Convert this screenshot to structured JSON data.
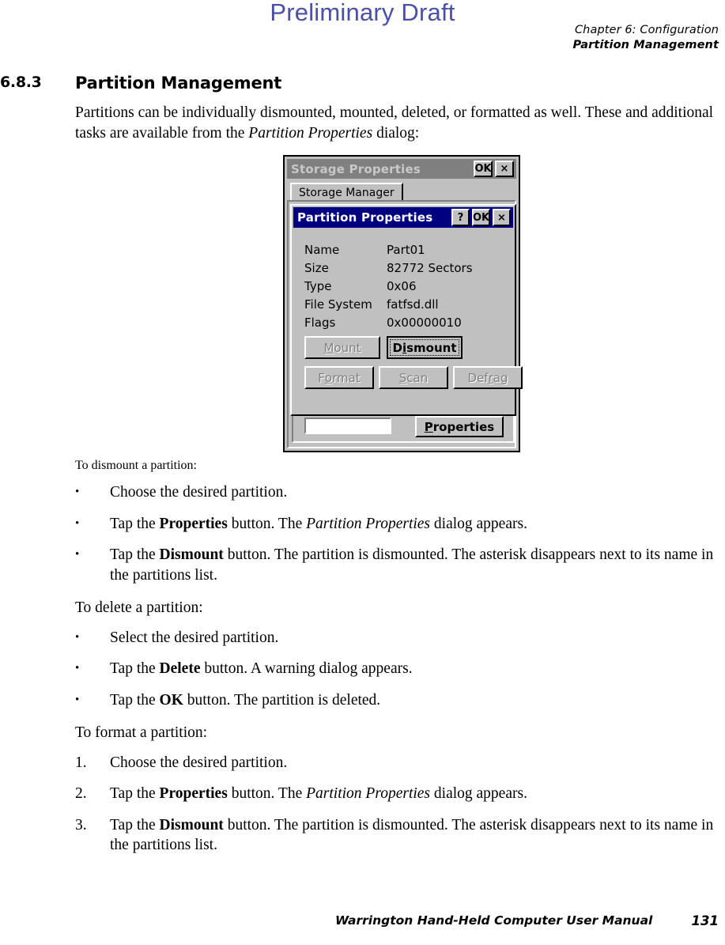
{
  "draft_stamp": "Preliminary Draft",
  "header": {
    "line1": "Chapter 6:  Configuration",
    "line2": "Partition Management"
  },
  "section": {
    "number": "6.8.3",
    "title": "Partition Management"
  },
  "intro": {
    "text_part1": "Partitions can be individually dismounted, mounted, deleted, or formatted as well. These and additional tasks are available from the ",
    "italic": "Partition Properties",
    "text_part2": " dialog:"
  },
  "figure": {
    "parent_window": {
      "title": "Storage Properties",
      "ok_label": "OK",
      "close_label": "×",
      "tab_label": "Storage Manager",
      "listbox_value": "",
      "properties_button": {
        "prefix": "",
        "mnemonic": "P",
        "suffix": "roperties"
      }
    },
    "child_dialog": {
      "title": "Partition Properties",
      "help_label": "?",
      "ok_label": "OK",
      "close_label": "×",
      "fields": [
        {
          "label": "Name",
          "value": "Part01"
        },
        {
          "label": "Size",
          "value": "82772 Sectors"
        },
        {
          "label": "Type",
          "value": "0x06"
        },
        {
          "label": "File System",
          "value": "fatfsd.dll"
        },
        {
          "label": "Flags",
          "value": "0x00000010"
        }
      ],
      "buttons": [
        {
          "name": "mount",
          "prefix": "",
          "mnemonic": "M",
          "suffix": "ount",
          "state": "disabled"
        },
        {
          "name": "dismount",
          "prefix": "D",
          "mnemonic": "i",
          "suffix": "smount",
          "state": "default"
        },
        {
          "name": "format",
          "prefix": "F",
          "mnemonic": "o",
          "suffix": "rmat",
          "state": "disabled"
        },
        {
          "name": "scan",
          "prefix": "",
          "mnemonic": "S",
          "suffix": "can",
          "state": "disabled"
        },
        {
          "name": "defrag",
          "prefix": "Def",
          "mnemonic": "r",
          "suffix": "ag",
          "state": "disabled"
        }
      ]
    }
  },
  "procedures": [
    {
      "lead": "To dismount a partition:",
      "marker_type": "bullet",
      "items": [
        {
          "marker": "•",
          "pre": "Choose the desired partition.",
          "bold": "",
          "mid": "",
          "italic": "",
          "post": ""
        },
        {
          "marker": "•",
          "pre": "Tap the ",
          "bold": "Properties",
          "mid": " button. The ",
          "italic": "Partition Properties",
          "post": " dialog appears."
        },
        {
          "marker": "•",
          "pre": "Tap the ",
          "bold": "Dismount",
          "mid": " button. The partition is dismounted. The asterisk disappears next to its name in the partitions list.",
          "italic": "",
          "post": ""
        }
      ]
    },
    {
      "lead": "To delete a partition:",
      "marker_type": "bullet",
      "items": [
        {
          "marker": "•",
          "pre": "Select the desired partition.",
          "bold": "",
          "mid": "",
          "italic": "",
          "post": ""
        },
        {
          "marker": "•",
          "pre": "Tap the ",
          "bold": "Delete",
          "mid": " button. A warning dialog appears.",
          "italic": "",
          "post": ""
        },
        {
          "marker": "•",
          "pre": "Tap the ",
          "bold": "OK",
          "mid": " button. The partition is deleted.",
          "italic": "",
          "post": ""
        }
      ]
    },
    {
      "lead": "To format a partition:",
      "marker_type": "number",
      "items": [
        {
          "marker": "1.",
          "pre": "Choose the desired partition.",
          "bold": "",
          "mid": "",
          "italic": "",
          "post": ""
        },
        {
          "marker": "2.",
          "pre": "Tap the ",
          "bold": "Properties",
          "mid": " button. The ",
          "italic": "Partition Properties",
          "post": " dialog appears."
        },
        {
          "marker": "3.",
          "pre": "Tap the ",
          "bold": "Dismount",
          "mid": " button. The partition is dismounted. The asterisk disappears next to its name in the partitions list.",
          "italic": "",
          "post": ""
        }
      ]
    }
  ],
  "footer": {
    "title": "Warrington Hand-Held Computer User Manual",
    "page_number": "131"
  },
  "colors": {
    "draft": "#4a4fa8",
    "titlebar_active": "#000080",
    "titlebar_inactive": "#808080",
    "dialog_face": "#c0c0c0"
  }
}
